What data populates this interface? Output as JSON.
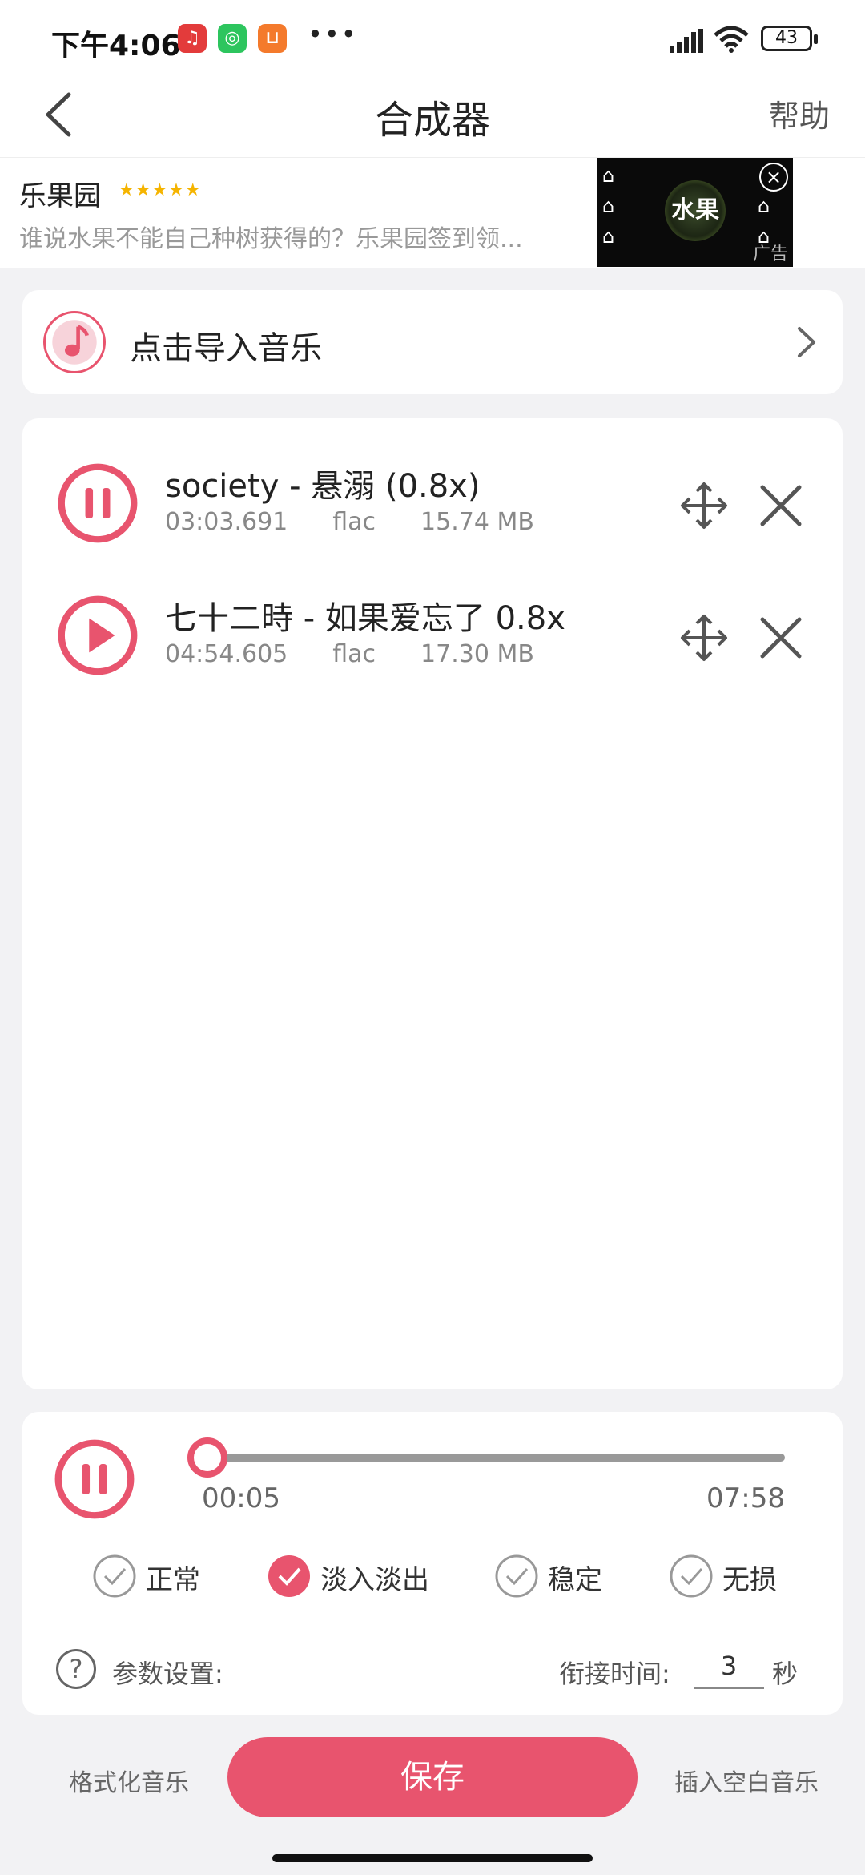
{
  "status_bar": {
    "time": "下午4:06",
    "apps": [
      {
        "icon": "netease-music-icon",
        "color": "#e33b3b"
      },
      {
        "icon": "wechat-icon",
        "color": "#2dc55e"
      },
      {
        "icon": "taobao-icon",
        "color": "#f47a2c"
      }
    ],
    "more": "•••",
    "battery": "43"
  },
  "header": {
    "back_icon": "chevron-left-icon",
    "title": "合成器",
    "help": "帮助"
  },
  "ad": {
    "title": "乐果园",
    "stars": "★★★★★",
    "description": "谁说水果不能自己种树获得的？乐果园签到领...",
    "logo_text": "水果",
    "close": "×",
    "label": "广告"
  },
  "import": {
    "icon": "music-note-icon",
    "label": "点击导入音乐",
    "chevron": "chevron-right-icon"
  },
  "tracks": [
    {
      "state": "playing",
      "name": "society - 悬溺 (0.8x)",
      "duration": "03:03.691",
      "format": "flac",
      "size": "15.74 MB"
    },
    {
      "state": "paused",
      "name": "七十二時 - 如果爱忘了 0.8x",
      "duration": "04:54.605",
      "format": "flac",
      "size": "17.30 MB"
    }
  ],
  "player": {
    "state": "playing",
    "current": "00:05",
    "total": "07:58",
    "progress": 0.01
  },
  "options": [
    {
      "label": "正常",
      "checked": false
    },
    {
      "label": "淡入淡出",
      "checked": true
    },
    {
      "label": "稳定",
      "checked": false
    },
    {
      "label": "无损",
      "checked": false
    }
  ],
  "params": {
    "icon": "?",
    "label": "参数设置:",
    "join_label": "衔接时间:",
    "join_value": "3",
    "join_unit": "秒"
  },
  "bottom": {
    "left": "格式化音乐",
    "save": "保存",
    "right": "插入空白音乐"
  },
  "colors": {
    "accent": "#e8546e"
  }
}
